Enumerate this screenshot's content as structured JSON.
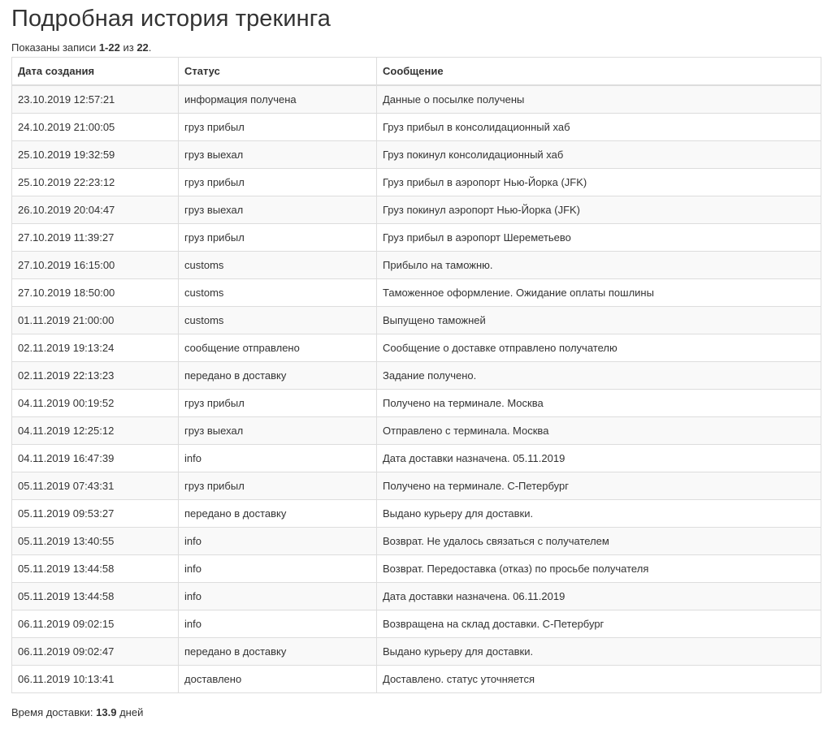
{
  "page": {
    "title": "Подробная история трекинга"
  },
  "summary": {
    "prefix": "Показаны записи ",
    "range": "1-22",
    "middle": " из ",
    "total": "22",
    "suffix": "."
  },
  "table": {
    "headers": [
      "Дата создания",
      "Статус",
      "Сообщение"
    ],
    "rows": [
      [
        "23.10.2019 12:57:21",
        "информация получена",
        "Данные о посылке получены"
      ],
      [
        "24.10.2019 21:00:05",
        "груз прибыл",
        "Груз прибыл в консолидационный хаб"
      ],
      [
        "25.10.2019 19:32:59",
        "груз выехал",
        "Груз покинул консолидационный хаб"
      ],
      [
        "25.10.2019 22:23:12",
        "груз прибыл",
        "Груз прибыл в аэропорт Нью-Йорка (JFK)"
      ],
      [
        "26.10.2019 20:04:47",
        "груз выехал",
        "Груз покинул аэропорт Нью-Йорка (JFK)"
      ],
      [
        "27.10.2019 11:39:27",
        "груз прибыл",
        "Груз прибыл в аэропорт Шереметьево"
      ],
      [
        "27.10.2019 16:15:00",
        "customs",
        "Прибыло на таможню."
      ],
      [
        "27.10.2019 18:50:00",
        "customs",
        "Таможенное оформление. Ожидание оплаты пошлины"
      ],
      [
        "01.11.2019 21:00:00",
        "customs",
        "Выпущено таможней"
      ],
      [
        "02.11.2019 19:13:24",
        "сообщение отправлено",
        "Сообщение о доставке отправлено получателю"
      ],
      [
        "02.11.2019 22:13:23",
        "передано в доставку",
        "Задание получено."
      ],
      [
        "04.11.2019 00:19:52",
        "груз прибыл",
        "Получено на терминале. Москва"
      ],
      [
        "04.11.2019 12:25:12",
        "груз выехал",
        "Отправлено с терминала. Москва"
      ],
      [
        "04.11.2019 16:47:39",
        "info",
        "Дата доставки назначена. 05.11.2019"
      ],
      [
        "05.11.2019 07:43:31",
        "груз прибыл",
        "Получено на терминале. С-Петербург"
      ],
      [
        "05.11.2019 09:53:27",
        "передано в доставку",
        "Выдано курьеру для доставки."
      ],
      [
        "05.11.2019 13:40:55",
        "info",
        "Возврат. Не удалось связаться с получателем"
      ],
      [
        "05.11.2019 13:44:58",
        "info",
        "Возврат. Передоставка (отказ) по просьбе получателя"
      ],
      [
        "05.11.2019 13:44:58",
        "info",
        "Дата доставки назначена. 06.11.2019"
      ],
      [
        "06.11.2019 09:02:15",
        "info",
        "Возвращена на склад доставки. С-Петербург"
      ],
      [
        "06.11.2019 09:02:47",
        "передано в доставку",
        "Выдано курьеру для доставки."
      ],
      [
        "06.11.2019 10:13:41",
        "доставлено",
        "Доставлено. статус уточняется"
      ]
    ]
  },
  "footer": {
    "label": "Время доставки: ",
    "value": "13.9",
    "unit": " дней"
  }
}
